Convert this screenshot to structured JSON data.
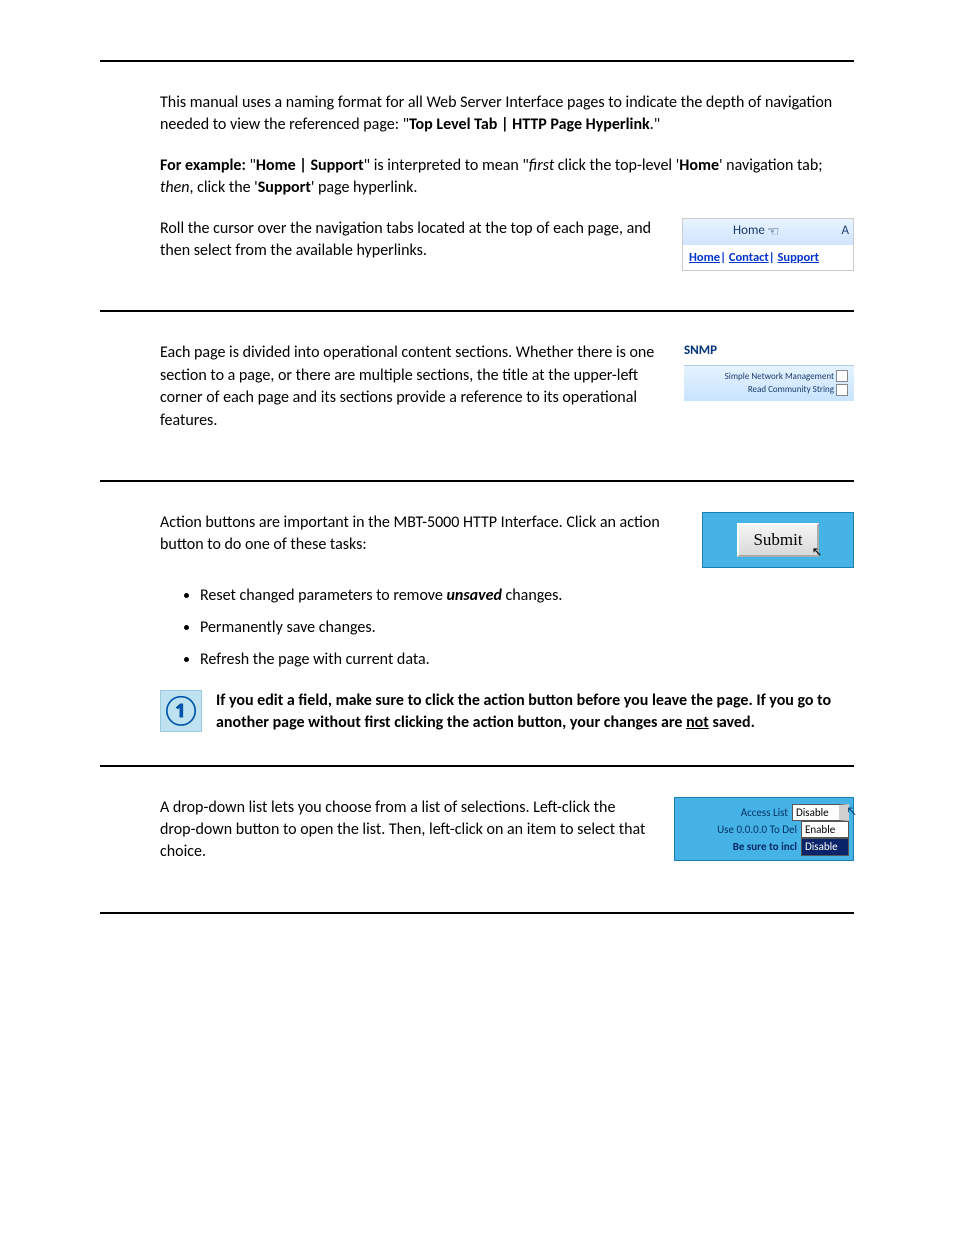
{
  "section1": {
    "p1_a": "This manual uses a naming format for all Web Server Interface pages to indicate the depth of navigation needed to view the referenced page: \"",
    "p1_bold": "Top Level Tab | HTTP Page Hyperlink",
    "p1_b": ".\"",
    "p2_lead_bold": "For example:",
    "p2_a": " \"",
    "p2_path_bold": "Home | Support",
    "p2_b": "\" is interpreted to mean \"",
    "p2_first_italic": "first",
    "p2_c": " click the top-level  '",
    "p2_home_bold": "Home",
    "p2_d": "' navigation tab; ",
    "p2_then_italic": "then",
    "p2_e": ", click the '",
    "p2_support_bold": "Support",
    "p2_f": "' page hyperlink.",
    "p3": "Roll the cursor over the navigation tabs located at the top of each page, and then select from the available hyperlinks.",
    "fig": {
      "tab1": "Home",
      "tab2": "A",
      "link1": "Home",
      "link2": "Contact",
      "link3": "Support"
    }
  },
  "section2": {
    "p1": "Each page is divided into operational content sections. Whether there is one section to a page, or there are multiple sections, the title at the upper-left corner of each page and its sections provide a reference to its operational features.",
    "fig": {
      "title": "SNMP",
      "line1": "Simple Network Management",
      "line2": "Read Community String"
    }
  },
  "section3": {
    "p1": "Action buttons are important in the MBT-5000 HTTP Interface. Click an action button to do one of these tasks:",
    "bullets": {
      "b1_a": "Reset changed parameters to remove ",
      "b1_bi": "unsaved",
      "b1_b": " changes.",
      "b2": "Permanently save changes.",
      "b3": "Refresh the page with current data."
    },
    "note_a": "If you edit a field, make sure to click the action button before you leave the page. If you go to another page without first clicking the action button, your changes are ",
    "note_not": "not",
    "note_b": " saved.",
    "fig": {
      "button": "Submit"
    }
  },
  "section4": {
    "p1": "A drop-down list lets you choose from a list of selections. Left-click the drop-down button to open the list. Then, left-click on an item to select that choice.",
    "fig": {
      "label1": "Access List",
      "sel_top": "Disable",
      "label2": "Use 0.0.0.0 To Del",
      "opt_enable": "Enable",
      "label3": "Be sure to incl",
      "opt_disable": "Disable"
    }
  }
}
